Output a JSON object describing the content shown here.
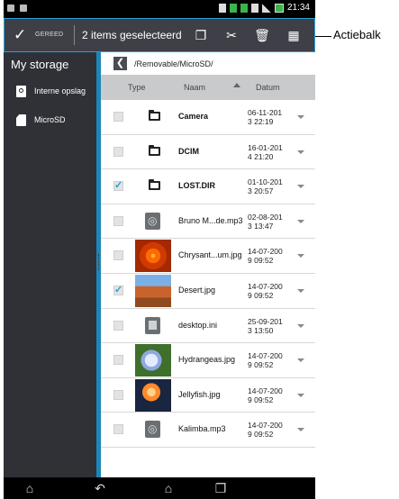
{
  "status_bar": {
    "time": "21:34",
    "icons": [
      "image-icon",
      "mail-icon",
      "vibrate-icon",
      "sim-icon",
      "signal-icon",
      "battery-icon"
    ]
  },
  "action_bar": {
    "done_label": "GEREED",
    "selection_text": "2 items geselecteerd",
    "actions": [
      "copy-icon",
      "cut-icon",
      "delete-icon",
      "select-all-icon"
    ],
    "border_color": "#2a9fd6"
  },
  "callout": {
    "label": "Actiebalk"
  },
  "sidebar": {
    "title": "My storage",
    "items": [
      {
        "label": "Interne opslag",
        "icon": "storage-icon"
      },
      {
        "label": "MicroSD",
        "icon": "sd-card-icon"
      }
    ]
  },
  "path": {
    "text": "/Removable/MicroSD/"
  },
  "columns": {
    "type": "Type",
    "name": "Naam",
    "date": "Datum"
  },
  "files": [
    {
      "name": "Camera",
      "date": "06-11-201\n3 22:19",
      "kind": "folder",
      "checked": false,
      "bold": true
    },
    {
      "name": "DCIM",
      "date": "16-01-201\n4 21:20",
      "kind": "folder",
      "checked": false,
      "bold": true
    },
    {
      "name": "LOST.DIR",
      "date": "01-10-201\n3 20:57",
      "kind": "folder",
      "checked": true,
      "bold": true
    },
    {
      "name": "Bruno M...de.mp3",
      "date": "02-08-201\n3 13:47",
      "kind": "audio",
      "checked": false,
      "bold": false
    },
    {
      "name": "Chrysant...um.jpg",
      "date": "14-07-200\n9 09:52",
      "kind": "chrysanthemum",
      "checked": false,
      "bold": false
    },
    {
      "name": "Desert.jpg",
      "date": "14-07-200\n9 09:52",
      "kind": "desert",
      "checked": true,
      "bold": false
    },
    {
      "name": "desktop.ini",
      "date": "25-09-201\n3 13:50",
      "kind": "ini",
      "checked": false,
      "bold": false
    },
    {
      "name": "Hydrangeas.jpg",
      "date": "14-07-200\n9 09:52",
      "kind": "hydrangeas",
      "checked": false,
      "bold": false
    },
    {
      "name": "Jellyfish.jpg",
      "date": "14-07-200\n9 09:52",
      "kind": "jellyfish",
      "checked": false,
      "bold": false
    },
    {
      "name": "Kalimba.mp3",
      "date": "14-07-200\n9 09:52",
      "kind": "audio",
      "checked": false,
      "bold": false
    }
  ],
  "nav_bar": {
    "buttons": [
      "home-icon",
      "back-icon",
      "home-outline-icon",
      "recent-apps-icon"
    ]
  }
}
